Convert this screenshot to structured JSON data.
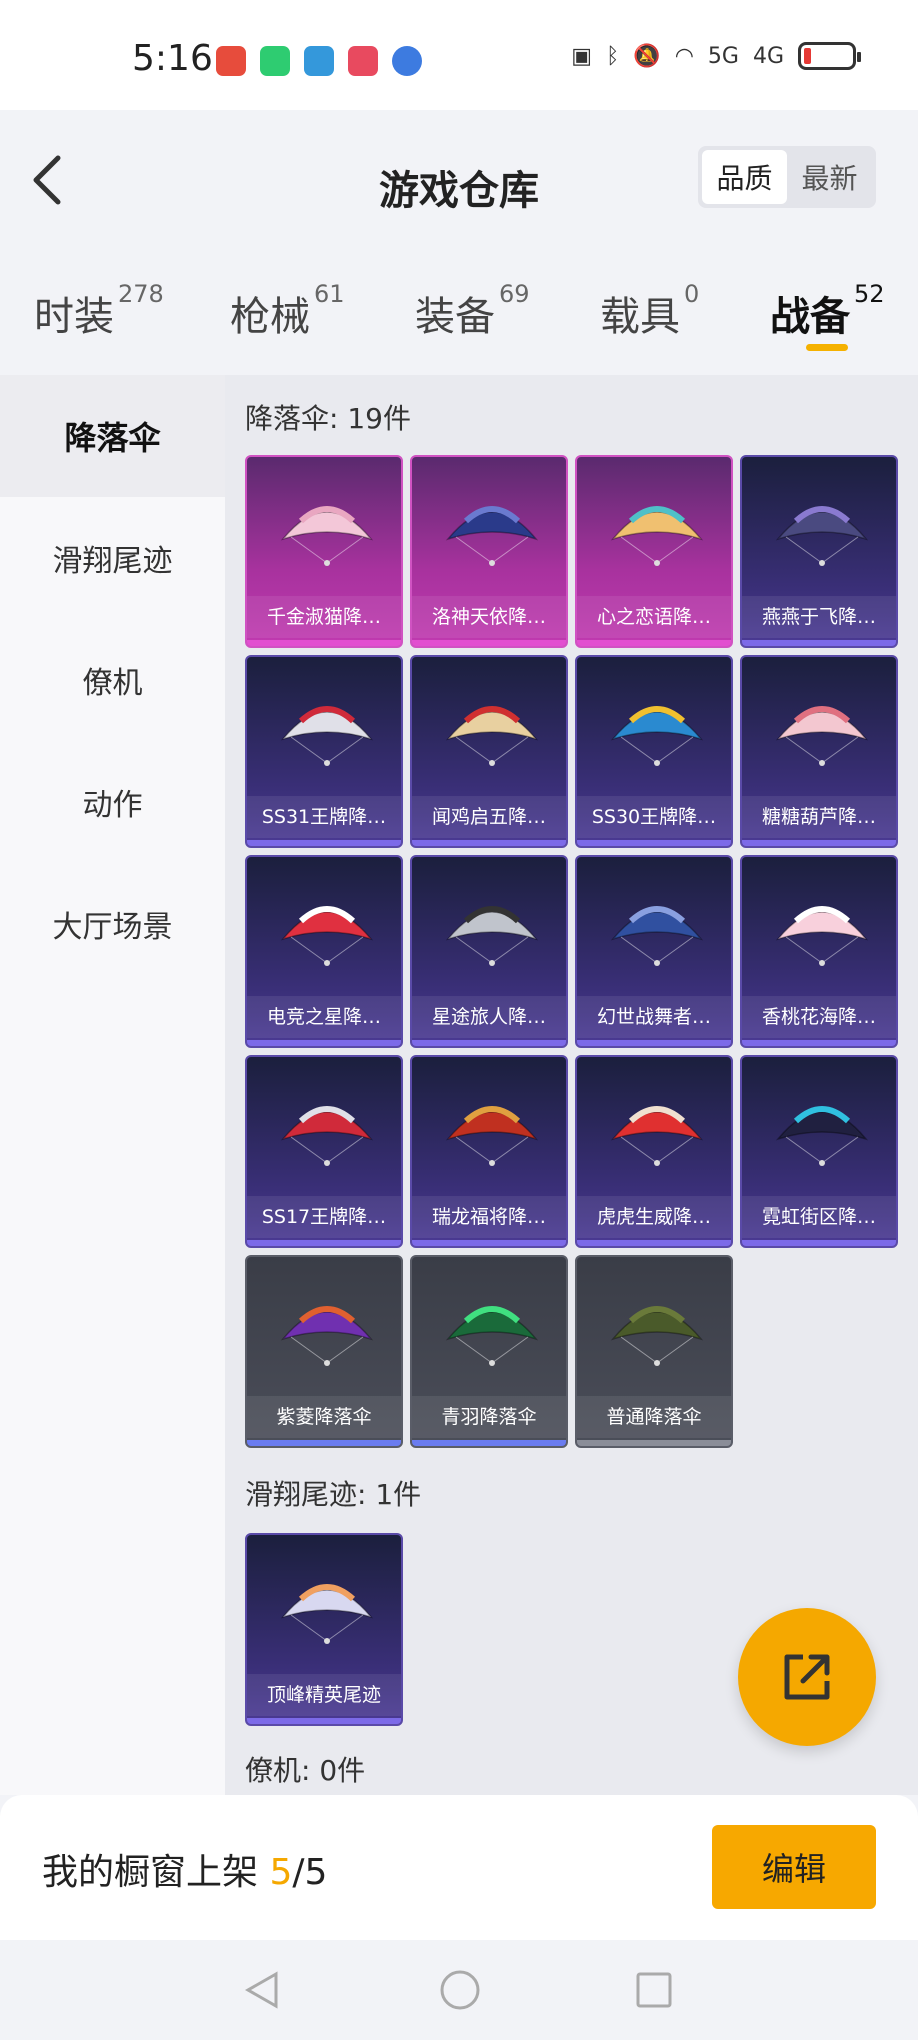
{
  "status_bar": {
    "time": "5:16",
    "network_5g": "5G",
    "network_4g": "4G"
  },
  "header": {
    "title": "游戏仓库",
    "sort_options": [
      "品质",
      "最新"
    ],
    "active_sort": "品质"
  },
  "tabs": [
    {
      "label": "时装",
      "count": "278"
    },
    {
      "label": "枪械",
      "count": "61"
    },
    {
      "label": "装备",
      "count": "69"
    },
    {
      "label": "载具",
      "count": "0"
    },
    {
      "label": "战备",
      "count": "52"
    }
  ],
  "sidebar": {
    "items": [
      "降落伞",
      "滑翔尾迹",
      "僚机",
      "动作",
      "大厅场景"
    ]
  },
  "sections": {
    "parachute": {
      "title": "降落伞: 19件",
      "items": [
        "千金淑猫降…",
        "洛神天依降…",
        "心之恋语降…",
        "燕燕于飞降…",
        "SS31王牌降…",
        "闻鸡启五降…",
        "SS30王牌降…",
        "糖糖葫芦降…",
        "电竞之星降…",
        "星途旅人降…",
        "幻世战舞者…",
        "香桃花海降…",
        "SS17王牌降…",
        "瑞龙福将降…",
        "虎虎生威降…",
        "霓虹街区降…",
        "紫菱降落伞",
        "青羽降落伞",
        "普通降落伞"
      ]
    },
    "trail": {
      "title": "滑翔尾迹: 1件",
      "items": [
        "顶峰精英尾迹"
      ]
    },
    "wingman": {
      "title": "僚机: 0件"
    }
  },
  "bottom": {
    "label": "我的橱窗上架 ",
    "current": "5",
    "sep_total": "/5",
    "edit": "编辑"
  },
  "colors": {
    "accent": "#f5a800",
    "legend": "#c03ab0",
    "epic": "#4b3a94",
    "common": "#4b4e59"
  }
}
